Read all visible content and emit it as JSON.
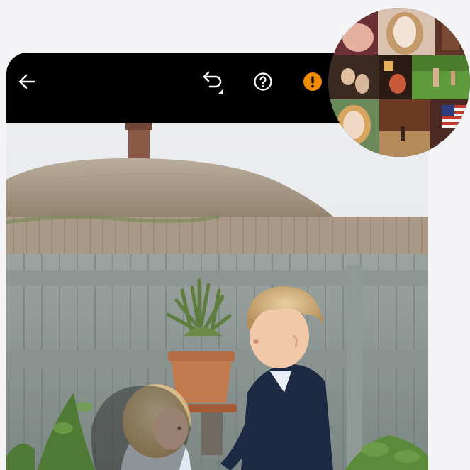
{
  "toolbar": {
    "back_icon": "arrow-left-icon",
    "undo_icon": "undo-icon",
    "help_icon": "question-circle-icon",
    "warning_icon": "exclamation-circle-icon",
    "colors": {
      "background": "#000000",
      "icon": "#ffffff",
      "warning": "#f08a00"
    }
  },
  "photo": {
    "subject": "two-children-in-garden-photo"
  },
  "collage": {
    "tiles": [
      "baby-photo-1",
      "baby-in-basket-photo",
      "family-photo-1",
      "kitchen-photo",
      "family-photo-2",
      "field-photo",
      "baby-in-basket-photo-2",
      "path-photo",
      "flag-photo"
    ]
  }
}
